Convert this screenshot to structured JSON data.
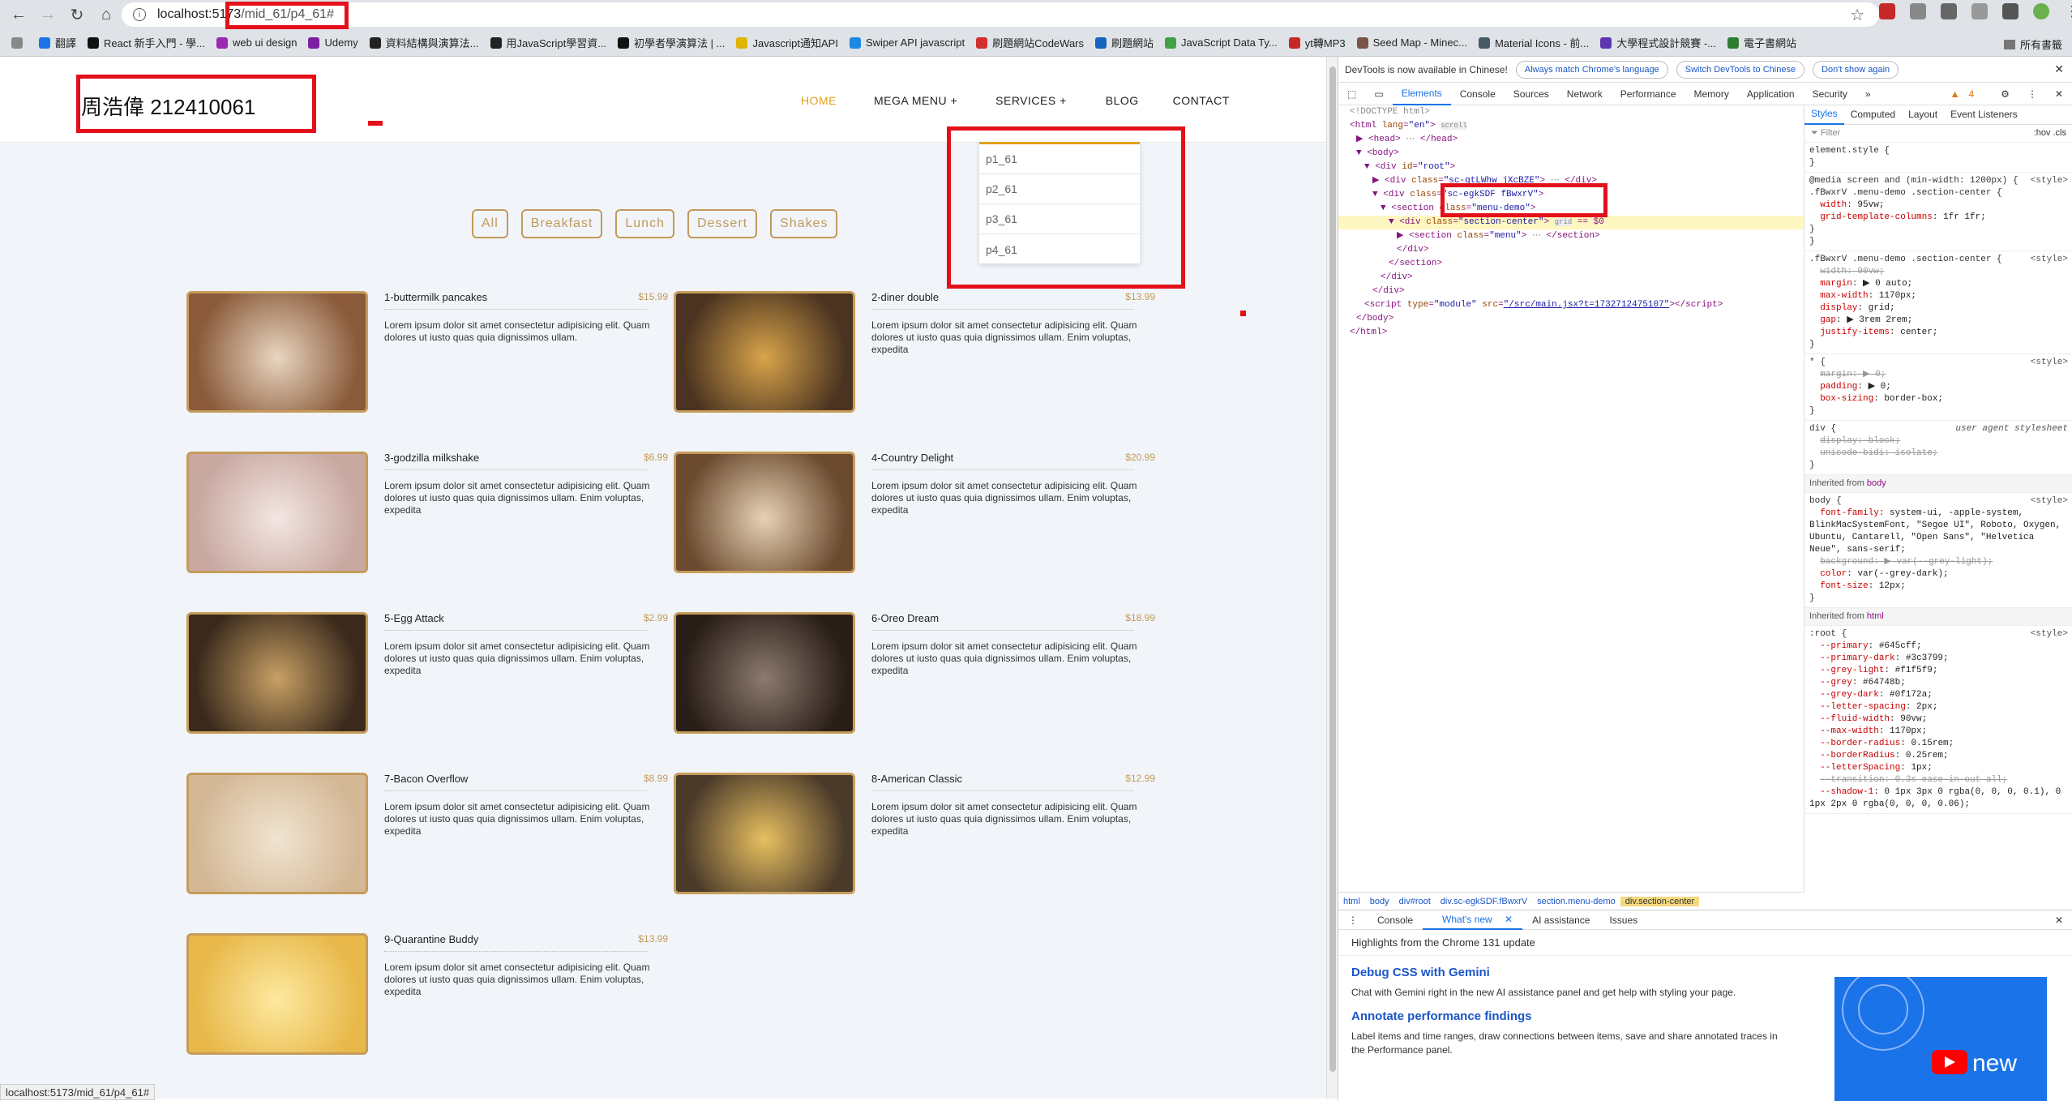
{
  "browser": {
    "url_host": "localhost:5173",
    "url_path": "/mid_61/p4_61#",
    "bookmarks": [
      "翻譯",
      "React 新手入門 - 學...",
      "web ui design",
      "Udemy",
      "資料結構與演算法...",
      "用JavaScript學習資...",
      "初學者學演算法 | ...",
      "Javascript通知API",
      "Swiper API javascript",
      "刷題網站CodeWars",
      "刷題網站",
      "JavaScript Data Ty...",
      "yt轉MP3",
      "Seed Map - Minec...",
      "Material Icons - 前...",
      "大學程式設計競賽 -...",
      "電子書網站"
    ],
    "bookmarks_right": "所有書籤",
    "status_url": "localhost:5173/mid_61/p4_61#"
  },
  "page": {
    "logo": "周浩偉 212410061",
    "nav": [
      "HOME",
      "MEGA MENU +",
      "SERVICES +",
      "BLOG",
      "CONTACT"
    ],
    "dropdown": [
      "p1_61",
      "p2_61",
      "p3_61",
      "p4_61"
    ],
    "filters": [
      "All",
      "Breakfast",
      "Lunch",
      "Dessert",
      "Shakes"
    ],
    "items": [
      {
        "title": "1-buttermilk pancakes",
        "price": "$15.99",
        "desc": "Lorem ipsum dolor sit amet consectetur adipisicing elit. Quam dolores ut iusto quas quia dignissimos ullam."
      },
      {
        "title": "2-diner double",
        "price": "$13.99",
        "desc": "Lorem ipsum dolor sit amet consectetur adipisicing elit. Quam dolores ut iusto quas quia dignissimos ullam. Enim voluptas, expedita"
      },
      {
        "title": "3-godzilla milkshake",
        "price": "$6.99",
        "desc": "Lorem ipsum dolor sit amet consectetur adipisicing elit. Quam dolores ut iusto quas quia dignissimos ullam. Enim voluptas, expedita"
      },
      {
        "title": "4-Country Delight",
        "price": "$20.99",
        "desc": "Lorem ipsum dolor sit amet consectetur adipisicing elit. Quam dolores ut iusto quas quia dignissimos ullam. Enim voluptas, expedita"
      },
      {
        "title": "5-Egg Attack",
        "price": "$2.99",
        "desc": "Lorem ipsum dolor sit amet consectetur adipisicing elit. Quam dolores ut iusto quas quia dignissimos ullam. Enim voluptas, expedita"
      },
      {
        "title": "6-Oreo Dream",
        "price": "$18.99",
        "desc": "Lorem ipsum dolor sit amet consectetur adipisicing elit. Quam dolores ut iusto quas quia dignissimos ullam. Enim voluptas, expedita"
      },
      {
        "title": "7-Bacon Overflow",
        "price": "$8.99",
        "desc": "Lorem ipsum dolor sit amet consectetur adipisicing elit. Quam dolores ut iusto quas quia dignissimos ullam. Enim voluptas, expedita"
      },
      {
        "title": "8-American Classic",
        "price": "$12.99",
        "desc": "Lorem ipsum dolor sit amet consectetur adipisicing elit. Quam dolores ut iusto quas quia dignissimos ullam. Enim voluptas, expedita"
      },
      {
        "title": "9-Quarantine Buddy",
        "price": "$13.99",
        "desc": "Lorem ipsum dolor sit amet consectetur adipisicing elit. Quam dolores ut iusto quas quia dignissimos ullam. Enim voluptas, expedita"
      }
    ]
  },
  "devtools": {
    "notice": "DevTools is now available in Chinese!",
    "notice_btns": [
      "Always match Chrome's language",
      "Switch DevTools to Chinese",
      "Don't show again"
    ],
    "tabs": [
      "Elements",
      "Console",
      "Sources",
      "Network",
      "Performance",
      "Memory",
      "Application",
      "Security"
    ],
    "issues_count": "4",
    "styles_tabs": [
      "Styles",
      "Computed",
      "Layout",
      "Event Listeners"
    ],
    "filter_placeholder": "Filter",
    "filter_tools": ":hov .cls",
    "breadcrumbs": [
      "html",
      "body",
      "div#root",
      "div.sc-egkSDF.fBwxrV",
      "section.menu-demo",
      "div.section-center"
    ],
    "drawer_tabs": [
      "Console",
      "What's new",
      "AI assistance",
      "Issues"
    ],
    "highlights": "Highlights from the Chrome 131 update",
    "h1": "Debug CSS with Gemini",
    "p1": "Chat with Gemini right in the new AI assistance panel and get help with styling your page.",
    "h2": "Annotate performance findings",
    "p2": "Label items and time ranges, draw connections between items, save and share annotated traces in the Performance panel.",
    "promo_text": "new"
  }
}
